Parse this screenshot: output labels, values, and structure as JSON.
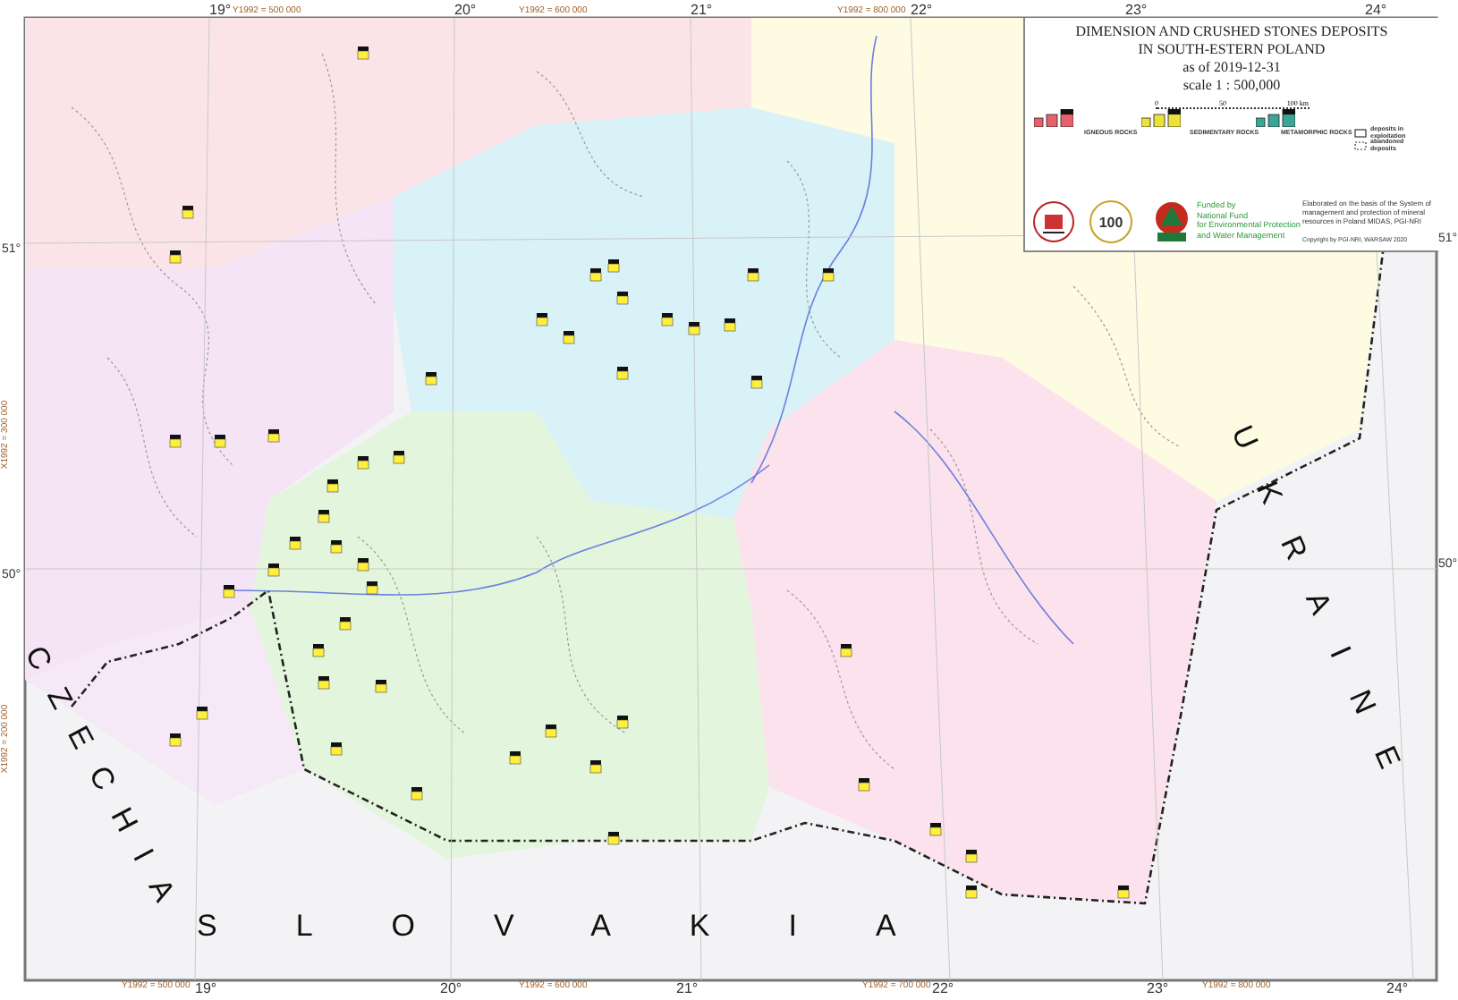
{
  "title_block": {
    "title_lines": [
      "DIMENSION AND CRUSHED STONES DEPOSITS",
      "IN SOUTH-ESTERN POLAND",
      "as of 2019-12-31"
    ],
    "scale": "scale  1 : 500,000",
    "scale_bar_labels": [
      "0",
      "50",
      "100 km"
    ]
  },
  "legend": {
    "groups": [
      {
        "heading": "IGNEOUS ROCKS",
        "color": "#e8606a"
      },
      {
        "heading": "SEDIMENTARY ROCKS",
        "color": "#ece23a"
      },
      {
        "heading": "METAMORPHIC ROCKS",
        "color": "#3aa595"
      }
    ],
    "symbols": [
      "deposits in exploitation",
      "abandoned deposits"
    ]
  },
  "credits": {
    "logo_text": "100",
    "funding_lines": [
      "Funded by",
      "National Fund",
      "for Environmental Protection",
      "and Water Management"
    ],
    "elaboration": "Elaborated on the basis of the System of management and protection of mineral resources in Poland MIDAS, PGI-NRI",
    "copyright": "Copyright by PGI-NRI, WARSAW 2020"
  },
  "graticule": {
    "longitudes_top": [
      "19°",
      "20°",
      "21°",
      "22°",
      "23°",
      "24°"
    ],
    "longitudes_bottom": [
      "19°",
      "20°",
      "21°",
      "22°",
      "23°",
      "24°"
    ],
    "latitudes_left": [
      "51°",
      "50°"
    ],
    "latitudes_right": [
      "51°",
      "50°"
    ],
    "grid_top": [
      "Y1992 = 500 000",
      "Y1992 = 600 000",
      "Y1992 = 800 000"
    ],
    "grid_bottom": [
      "Y1992 = 500 000",
      "Y1992 = 600 000",
      "Y1992 = 700 000",
      "Y1992 = 800 000"
    ],
    "grid_left": [
      "X1992 = 300 000",
      "X1992 = 200 000"
    ]
  },
  "countries": [
    "CZECHIA",
    "SLOVAKIA",
    "UKRAINE"
  ]
}
